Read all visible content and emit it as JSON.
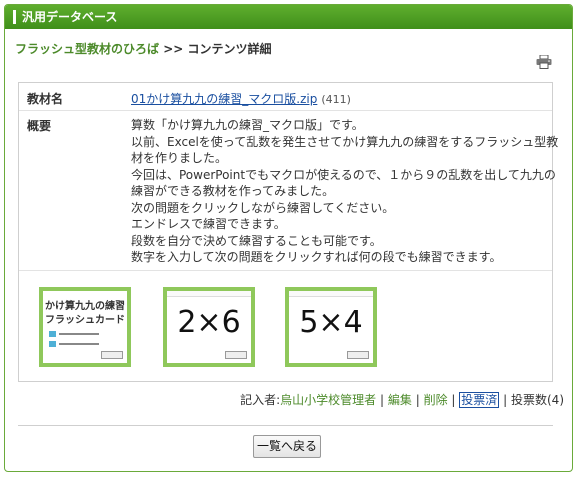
{
  "header": {
    "title": "汎用データベース"
  },
  "breadcrumb": {
    "parent": "フラッシュ型教材のひろば",
    "separator": ">>",
    "current": "コンテンツ詳細"
  },
  "detail": {
    "name_label": "教材名",
    "file_name": "01かけ算九九の練習_マクロ版.zip",
    "file_size": "(411)",
    "summary_label": "概要",
    "summary_lines": [
      "算数「かけ算九九の練習_マクロ版」です。",
      "以前、Excelを使って乱数を発生させてかけ算九九の練習をするフラッシュ型教",
      "材を作りました。",
      "今回は、PowerPointでもマクロが使えるので、１から９の乱数を出して九九の",
      "練習ができる教材を作ってみました。",
      "次の問題をクリックしながら練習してください。",
      "エンドレスで練習できます。",
      "段数を自分で決めて練習することも可能です。",
      "数字を入力して次の問題をクリックすれば何の段でも練習できます。"
    ]
  },
  "thumbnails": {
    "t1_title1": "かけ算九九の練習",
    "t1_title2": "フラッシュカード",
    "t2_text": "2×6",
    "t3_text": "5×4"
  },
  "footer": {
    "author_label": "記入者:",
    "author": "烏山小学校管理者",
    "sep": "|",
    "edit": "編集",
    "delete": "削除",
    "voted": "投票済",
    "votes": "投票数(4)"
  },
  "back_button": "一覧へ戻る",
  "icons": {
    "print": "printer-icon"
  },
  "colors": {
    "header_green": "#4c9e24",
    "link_blue": "#1a4fa0",
    "text_green": "#4c8a2a"
  }
}
